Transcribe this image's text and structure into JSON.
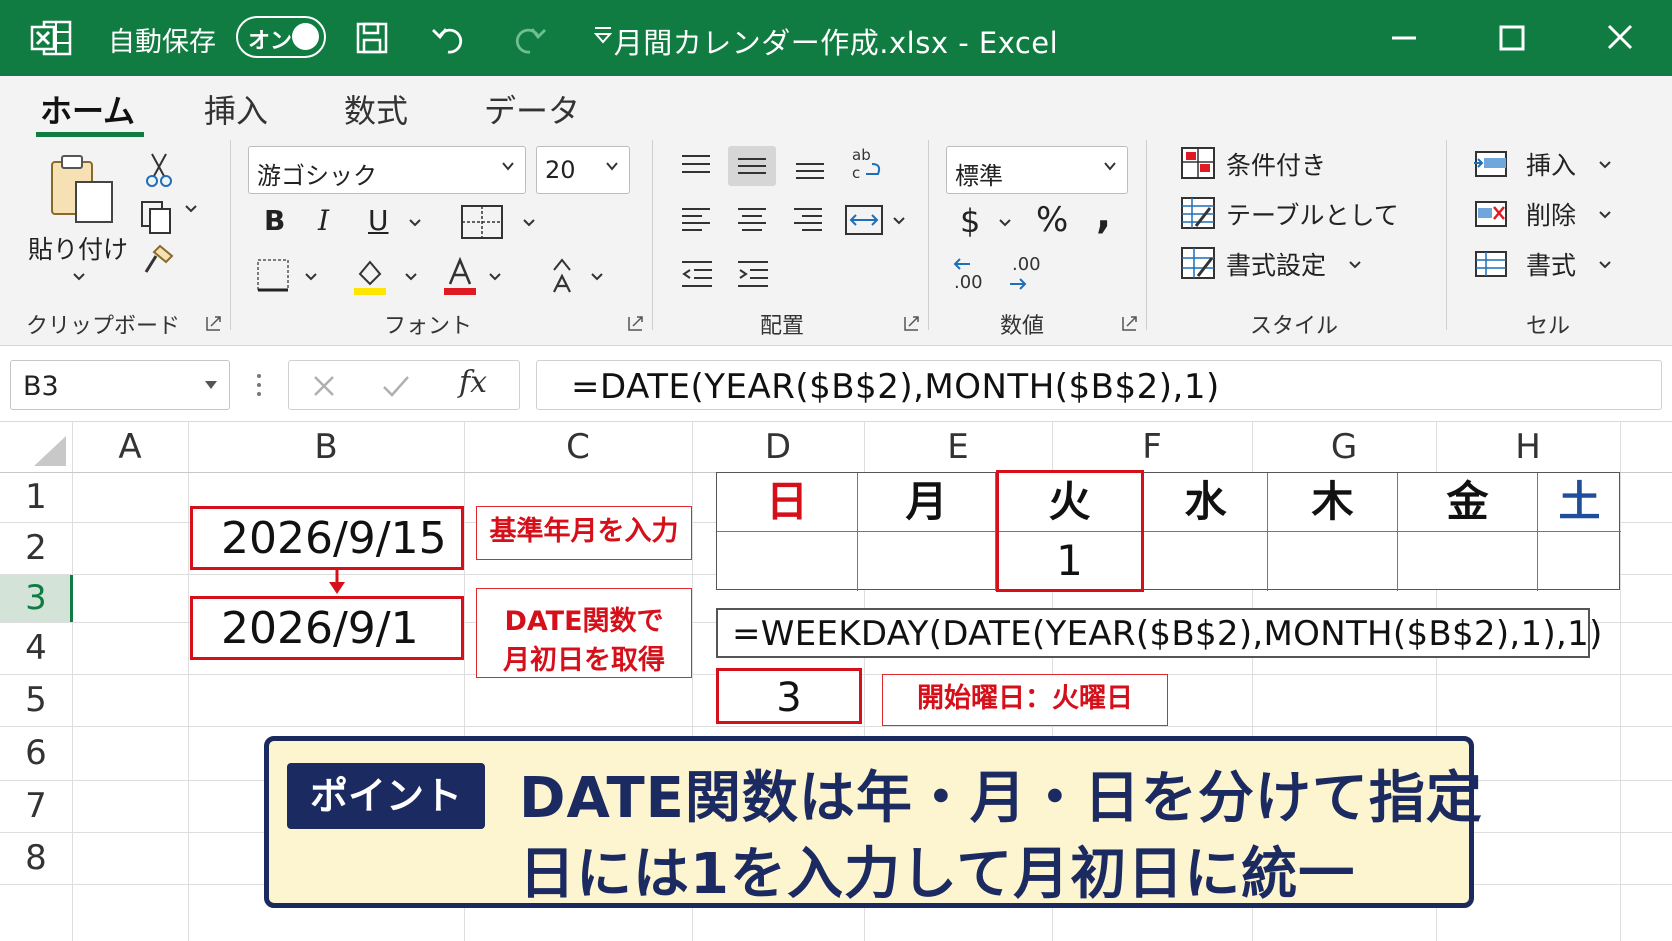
{
  "titlebar": {
    "autosave_label": "自動保存",
    "autosave_state": "オン",
    "title": "月間カレンダー作成.xlsx  -  Excel"
  },
  "tabs": [
    {
      "label": "ホーム",
      "active": true
    },
    {
      "label": "挿入"
    },
    {
      "label": "数式"
    },
    {
      "label": "データ"
    }
  ],
  "ribbon": {
    "clipboard": {
      "paste_label": "貼り付け",
      "group_label": "クリップボード"
    },
    "font": {
      "name": "游ゴシック",
      "size": "20",
      "group_label": "フォント",
      "bold": "B",
      "italic": "I",
      "underline": "U"
    },
    "alignment": {
      "group_label": "配置"
    },
    "number": {
      "format": "標準",
      "currency": "$",
      "percent": "%",
      "comma": ",",
      "inc_decimal": ".00",
      "dec_decimal": ".00",
      "group_label": "数値"
    },
    "styles": {
      "conditional": "条件付き",
      "table": "テーブルとして",
      "cell_styles": "書式設定",
      "group_label": "スタイル"
    },
    "cells": {
      "insert": "挿入",
      "delete": "削除",
      "format": "書式",
      "group_label": "セル"
    }
  },
  "formula_bar": {
    "name_box": "B3",
    "fx": "fx",
    "formula": "=DATE(YEAR($B$2),MONTH($B$2),1)"
  },
  "columns": [
    "A",
    "B",
    "C",
    "D",
    "E",
    "F",
    "G",
    "H"
  ],
  "rows": [
    "1",
    "2",
    "3",
    "4",
    "5",
    "6",
    "7",
    "8"
  ],
  "selected_row": "3",
  "cells": {
    "b2": "2026/9/15",
    "b3": "2026/9/1",
    "c2_note": "基準年月を入力",
    "c3_note_line1": "DATE関数で",
    "c3_note_line2": "月初日を取得",
    "weekday_formula": "=WEEKDAY(DATE(YEAR($B$2),MONTH($B$2),1),1)",
    "weekday_result": "3",
    "weekday_note": "開始曜日：火曜日"
  },
  "calendar": {
    "days": [
      "日",
      "月",
      "火",
      "水",
      "木",
      "金",
      "土"
    ],
    "first_row": [
      "",
      "",
      "1",
      "",
      "",
      "",
      ""
    ],
    "colors": {
      "sunday": "#d6101a",
      "saturday": "#1f4e9c",
      "weekday": "#111111",
      "highlight": "#d6101a"
    }
  },
  "banner": {
    "badge": "ポイント",
    "line1": "DATE関数は年・月・日を分けて指定",
    "line2": "日には1を入力して月初日に統一"
  },
  "theme": {
    "excel_green": "#107c41",
    "accent_red": "#d6101a",
    "banner_navy": "#1b2a60",
    "banner_bg": "#fdf5cf"
  }
}
